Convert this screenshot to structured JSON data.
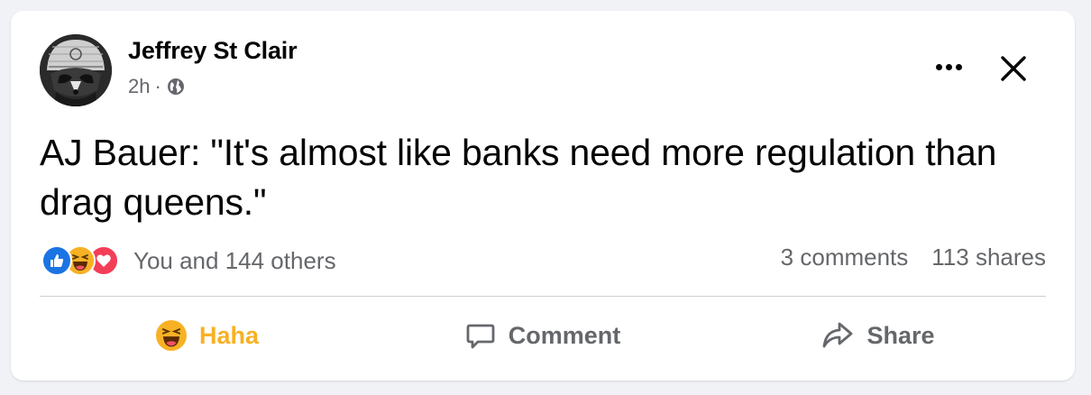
{
  "post": {
    "author": "Jeffrey St Clair",
    "time": "2h",
    "separator": "·",
    "visibility_icon": "globe-icon",
    "text": "AJ Bauer: \"It's almost like banks need more regulation than drag queens.\""
  },
  "engagement": {
    "reaction_icons": [
      "like-icon",
      "haha-icon",
      "love-icon"
    ],
    "reaction_summary": "You and 144 others",
    "comments": "3 comments",
    "shares": "113 shares"
  },
  "actions": {
    "haha_label": "Haha",
    "comment_label": "Comment",
    "share_label": "Share"
  },
  "colors": {
    "background": "#f0f2f5",
    "card": "#ffffff",
    "text": "#050505",
    "secondary": "#65676b",
    "like_blue": "#1b74e4",
    "haha_yellow": "#f7b125",
    "love_red": "#f33e58",
    "divider": "#ced0d4"
  }
}
